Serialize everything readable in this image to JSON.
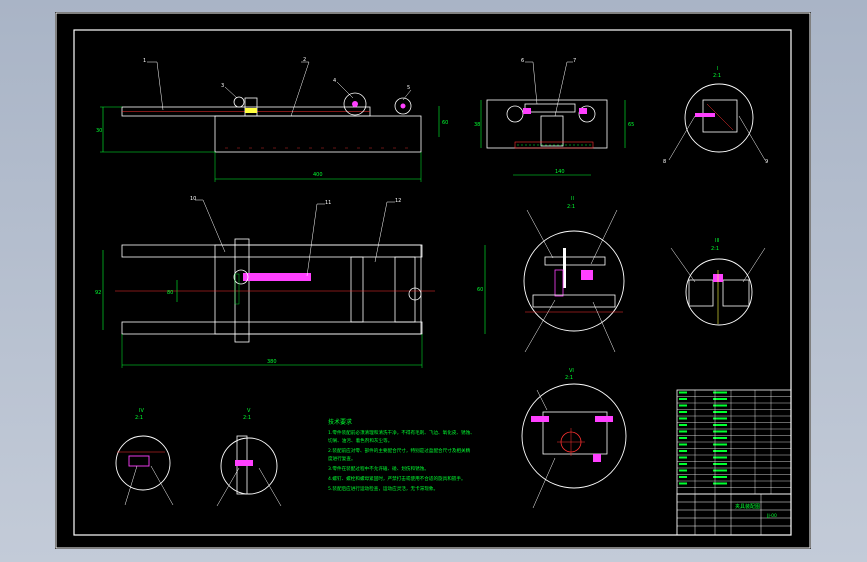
{
  "colors": {
    "background": "#b7c0cf",
    "sheet": "#000000",
    "outline": "#ffffff",
    "dimension": "#00ff30",
    "section": "#ff3030",
    "part": "#ff40ff",
    "accent": "#ffff40"
  },
  "drawing": {
    "dimensions": {
      "top_view_length": "400",
      "top_view_height": "30",
      "top_view_right": "60",
      "side_height": "38",
      "side_height_right": "65",
      "side_width": "140",
      "plan_length": "380",
      "plan_width": "92",
      "plan_height": "60",
      "plan_inner": "80"
    },
    "callouts": {
      "c1": "1",
      "c2": "2",
      "c3": "3",
      "c4": "4",
      "c5": "5",
      "c6": "6",
      "c7": "7",
      "c8": "8",
      "c9": "9",
      "c10": "10",
      "c11": "11",
      "c12": "12"
    },
    "view_labels": {
      "detail_i": "I",
      "detail_i_scale": "2:1",
      "detail_ii": "II",
      "detail_ii_scale": "2:1",
      "detail_iii": "III",
      "detail_iii_scale": "2:1",
      "detail_iv": "IV",
      "detail_iv_scale": "2:1",
      "detail_v": "V",
      "detail_v_scale": "2:1",
      "detail_vi": "VI",
      "detail_vi_scale": "2:1",
      "detail_vii": "VII",
      "detail_vii_scale": "2:1"
    },
    "notes": {
      "title": "技术要求",
      "lines": [
        "1.零件装配前必须清理和清洗干净，不得有毛刺、飞边、氧化皮、锈蚀、",
        "  切屑、油污、着色剂和灰尘等。",
        "2.装配前应对零、部件的主要配合尺寸，特别是过盈配合尺寸及相关精",
        "  度进行复查。",
        "3.零件在装配过程中不允许磕、碰、划伤和锈蚀。",
        "4.螺钉、螺栓和螺母紧固时，严禁打击或使用不合适的旋具和扳手。",
        "5.装配后应进行运动检查，运动应灵活，无卡滞现象。"
      ]
    }
  },
  "title_block": {
    "title": "夹具装配图",
    "drawing_no": "JJ-00",
    "parts_rows": 16,
    "headers": [
      "序号",
      "代号",
      "名称",
      "数量",
      "材料",
      "备注"
    ]
  }
}
